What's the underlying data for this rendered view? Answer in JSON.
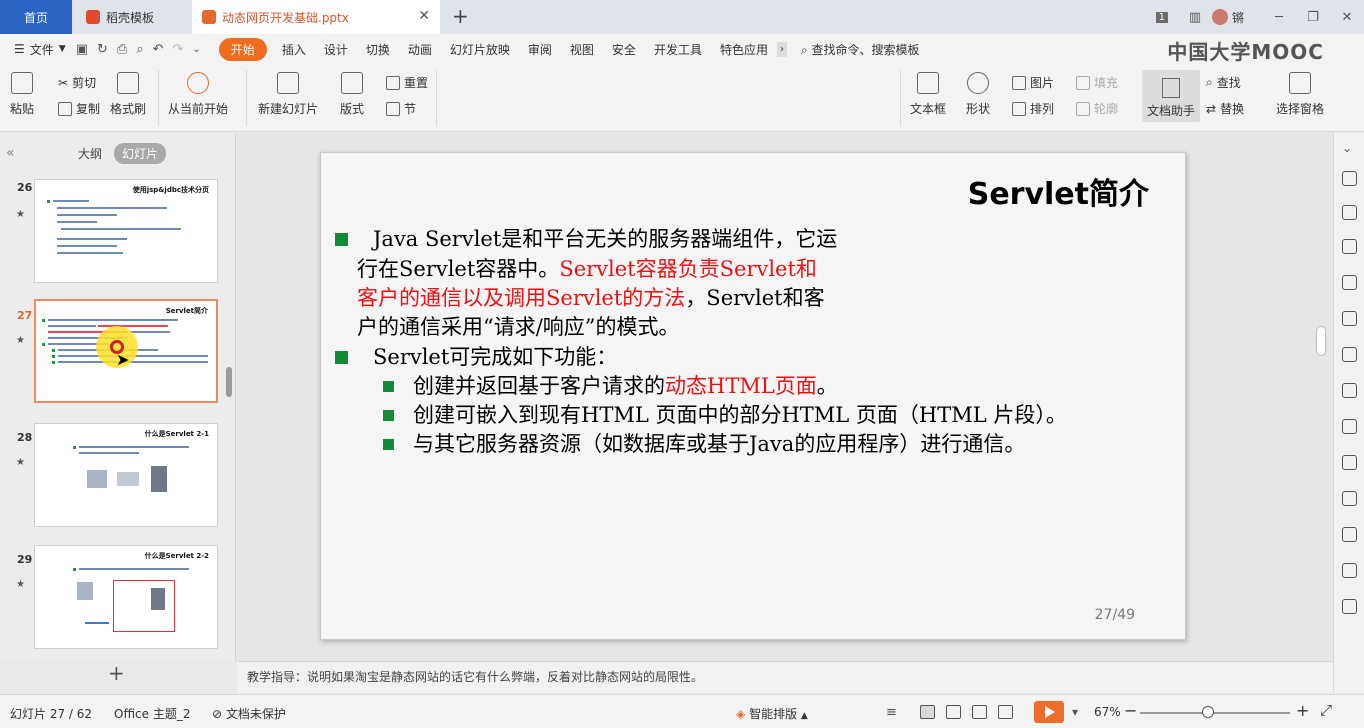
{
  "tabs": {
    "home": "首页",
    "docer": "稻壳模板",
    "file": "动态网页开发基础.pptx"
  },
  "window": {
    "badge": "1",
    "user": "锵"
  },
  "menu": {
    "file": "文件",
    "items": [
      "开始",
      "插入",
      "设计",
      "切换",
      "动画",
      "幻灯片放映",
      "审阅",
      "视图",
      "安全",
      "开发工具",
      "特色应用"
    ],
    "active": "开始",
    "search": "查找命令、搜索模板",
    "logo": "中国大学MOOC"
  },
  "ribbon": {
    "paste": "粘贴",
    "cut": "剪切",
    "copy": "复制",
    "format_painter": "格式刷",
    "from_current": "从当前开始",
    "new_slide": "新建幻灯片",
    "layout": "版式",
    "reset": "重置",
    "section": "节",
    "textbox": "文本框",
    "shape": "形状",
    "picture": "图片",
    "fill": "填充",
    "arrange": "排列",
    "outline": "轮廓",
    "doc_assistant": "文档助手",
    "find": "查找",
    "replace": "替换",
    "select_pane": "选择窗格"
  },
  "left_panel": {
    "outline_tab": "大纲",
    "slides_tab": "幻灯片",
    "thumbs": [
      {
        "num": "26",
        "title": "使用jsp&jdbc技术分页"
      },
      {
        "num": "27",
        "title": "Servlet简介",
        "selected": true
      },
      {
        "num": "28",
        "title": "什么是Servlet 2-1"
      },
      {
        "num": "29",
        "title": "什么是Servlet 2-2"
      }
    ]
  },
  "slide": {
    "title": "Servlet简介",
    "p1_l1": "Java Servlet是和平台无关的服务器端组件，它运",
    "p1_l2a": "行在Servlet容器中。",
    "p1_l2b": "Servlet容器负责Servlet和",
    "p1_l3a": "客户的通信以及调用Servlet的方法",
    "p1_l3b": "，Servlet和客",
    "p1_l4": "户的通信采用“请求/响应”的模式。",
    "p2": "Servlet可完成如下功能：",
    "b1a": "创建并返回基于客户请求的",
    "b1b": "动态HTML页面",
    "b1c": "。",
    "b2": "创建可嵌入到现有HTML 页面中的部分HTML 页面（HTML 片段）。",
    "b3": "与其它服务器资源（如数据库或基于Java的应用程序）进行通信。",
    "page": "27/49"
  },
  "notes": "教学指导：说明如果淘宝是静态网站的话它有什么弊端，反着对比静态网站的局限性。",
  "status": {
    "slide_pos": "幻灯片 27 / 62",
    "theme": "Office 主题_2",
    "protect": "文档未保护",
    "smart_layout": "智能排版",
    "zoom": "67%"
  },
  "colors": {
    "accent": "#ef6c1f",
    "home_tab": "#2a64c5",
    "bullet": "#138a36",
    "highlight_text": "#ee1010"
  }
}
